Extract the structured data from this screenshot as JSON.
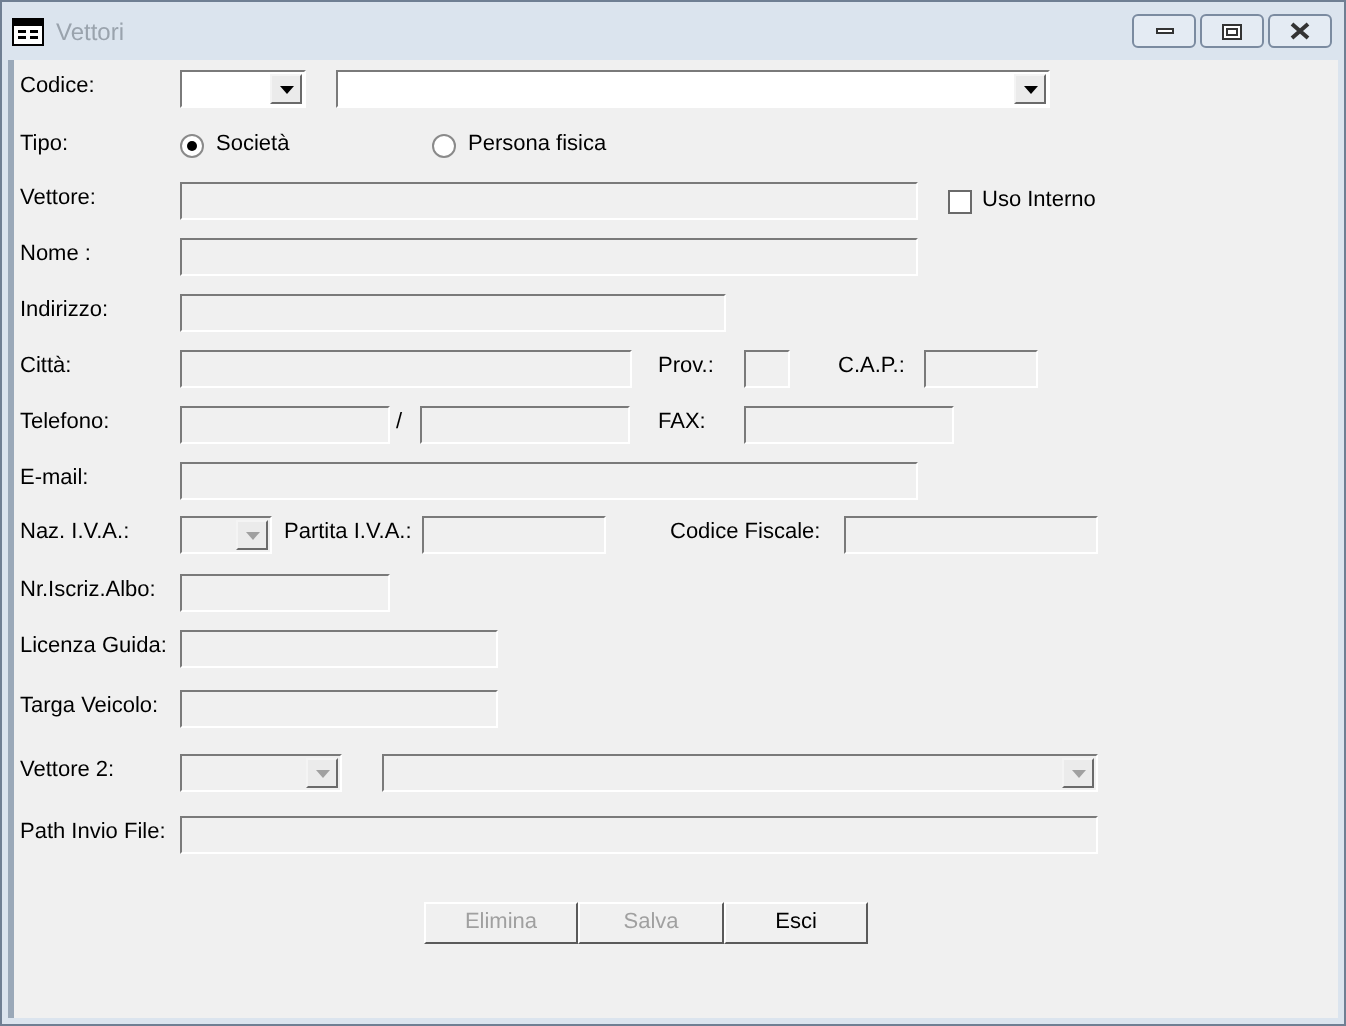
{
  "window": {
    "title": "Vettori"
  },
  "rows": [
    {
      "items": [
        {
          "kind": "label",
          "text": "Codice:"
        },
        {
          "kind": "combo",
          "disabled": false
        },
        {
          "kind": "combo",
          "disabled": false
        }
      ]
    },
    {
      "items": [
        {
          "kind": "label",
          "text": "Tipo:"
        },
        {
          "kind": "radio",
          "text": "Società",
          "selected": true
        },
        {
          "kind": "radio",
          "text": "Persona fisica",
          "selected": false
        }
      ]
    },
    {
      "items": [
        {
          "kind": "label",
          "text": "Vettore:"
        },
        {
          "kind": "field",
          "disabled": true
        },
        {
          "kind": "checkbox",
          "text": "Uso Interno",
          "checked": false
        }
      ]
    },
    {
      "items": [
        {
          "kind": "label",
          "text": "Nome :"
        },
        {
          "kind": "field",
          "disabled": true
        }
      ]
    },
    {
      "items": [
        {
          "kind": "label",
          "text": "Indirizzo:"
        },
        {
          "kind": "field",
          "disabled": true
        }
      ]
    },
    {
      "items": [
        {
          "kind": "label",
          "text": "Città:"
        },
        {
          "kind": "field",
          "disabled": true
        },
        {
          "kind": "label",
          "text": "Prov.:"
        },
        {
          "kind": "field",
          "disabled": true
        },
        {
          "kind": "label",
          "text": "C.A.P.:"
        },
        {
          "kind": "field",
          "disabled": true
        }
      ]
    },
    {
      "items": [
        {
          "kind": "label",
          "text": "Telefono:"
        },
        {
          "kind": "field",
          "disabled": true
        },
        {
          "kind": "label",
          "text": "/"
        },
        {
          "kind": "field",
          "disabled": true
        },
        {
          "kind": "label",
          "text": "FAX:"
        },
        {
          "kind": "field",
          "disabled": true
        }
      ]
    },
    {
      "items": [
        {
          "kind": "label",
          "text": "E-mail:"
        },
        {
          "kind": "field",
          "disabled": true
        }
      ]
    },
    {
      "items": [
        {
          "kind": "label",
          "text": "Naz. I.V.A.:"
        },
        {
          "kind": "combo",
          "disabled": true
        },
        {
          "kind": "label",
          "text": "Partita I.V.A.:"
        },
        {
          "kind": "field",
          "disabled": true
        },
        {
          "kind": "label",
          "text": "Codice Fiscale:"
        },
        {
          "kind": "field",
          "disabled": true
        }
      ]
    },
    {
      "items": [
        {
          "kind": "label",
          "text": "Nr.Iscriz.Albo:"
        },
        {
          "kind": "field",
          "disabled": true
        }
      ]
    },
    {
      "items": [
        {
          "kind": "label",
          "text": "Licenza Guida:"
        },
        {
          "kind": "field",
          "disabled": true
        }
      ]
    },
    {
      "items": [
        {
          "kind": "label",
          "text": "Targa Veicolo:"
        },
        {
          "kind": "field",
          "disabled": true
        }
      ]
    },
    {
      "items": [
        {
          "kind": "label",
          "text": "Vettore 2:"
        },
        {
          "kind": "combo",
          "disabled": true
        },
        {
          "kind": "combo",
          "disabled": true
        }
      ]
    },
    {
      "items": [
        {
          "kind": "label",
          "text": "Path Invio File:"
        },
        {
          "kind": "field",
          "disabled": true
        }
      ]
    }
  ],
  "buttons": [
    {
      "label": "Elimina",
      "disabled": true
    },
    {
      "label": "Salva",
      "disabled": true
    },
    {
      "label": "Esci",
      "disabled": false
    }
  ]
}
